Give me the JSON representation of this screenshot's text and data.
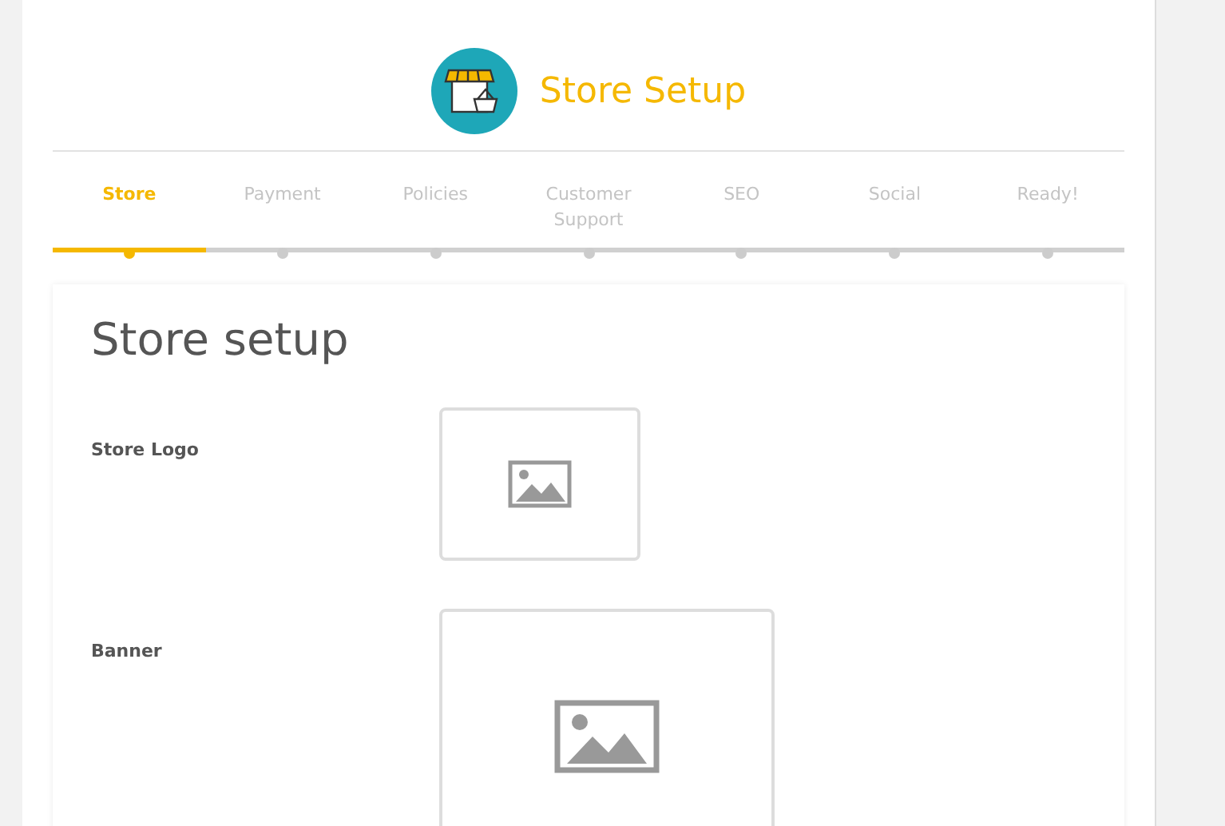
{
  "header": {
    "title": "Store Setup"
  },
  "steps": [
    {
      "label": "Store",
      "selected": true
    },
    {
      "label": "Payment",
      "selected": false
    },
    {
      "label": "Policies",
      "selected": false
    },
    {
      "label": "Customer Support",
      "selected": false
    },
    {
      "label": "SEO",
      "selected": false
    },
    {
      "label": "Social",
      "selected": false
    },
    {
      "label": "Ready!",
      "selected": false
    }
  ],
  "form": {
    "title": "Store setup",
    "fields": [
      {
        "label": "Store Logo",
        "kind": "logo"
      },
      {
        "label": "Banner",
        "kind": "banner"
      }
    ]
  }
}
